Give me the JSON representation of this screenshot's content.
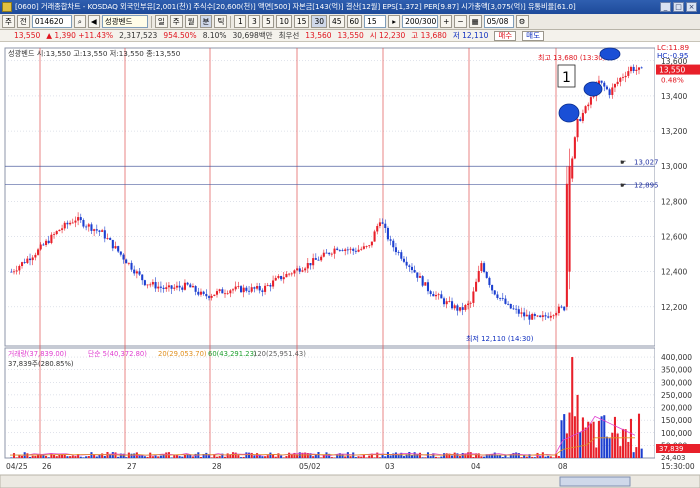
{
  "window": {
    "title": "[0600] 거래종합차트 - KOSDAQ 외국인부유[2,001(천)] 주식수[20,600(천)] 액면[500] 자본금[143(억)] 결산[12월] EPS[1,372] PER[9.87] 시가총액[3,075(억)] 유통비율[61.0]",
    "controls": [
      "_",
      "□",
      "×"
    ]
  },
  "toolbar": {
    "period_type": "주",
    "period_sel": "전",
    "code": "014620",
    "name": "성광벤드",
    "buttons": [
      "일",
      "주",
      "월",
      "분",
      "틱"
    ],
    "intervals": [
      "1",
      "3",
      "5",
      "10",
      "15",
      "30",
      "45",
      "60"
    ],
    "count": "15",
    "range": "200/300",
    "date": "05/08"
  },
  "info": {
    "price": "13,550",
    "change": "▲ 1,390 +11.43%",
    "volume": "2,317,523",
    "vol_pct": "954.50%",
    "turnover": "8.10%",
    "amount": "30,698백만",
    "prev_label": "최우선",
    "prev_price": "13,560",
    "prev_price2": "13,550",
    "low_label": "시 12,230",
    "high_label": "고 13,680",
    "close_label": "저 12,110",
    "buy": "매수",
    "sell": "매도"
  },
  "price_panel": {
    "legend": "성광벤드 시:13,550 고:13,550 저:13,550 종:13,550",
    "lc": "LC:11.89",
    "hc": "HC:-0.95",
    "high_annot": "최고 13,680 (13:30)",
    "low_annot": "최저 12,110 (14:30)",
    "box_num": "1",
    "cur_price": "13,550",
    "cur_pct": "0.48%",
    "ref_lines": [
      {
        "value": 13027,
        "label": "13,027"
      },
      {
        "value": 12895,
        "label": "12,895"
      }
    ],
    "horiz_lines": [
      13000,
      12895
    ]
  },
  "volume_panel": {
    "legend": [
      "거래량(37,839.00)",
      "단순 5(40,372.80)",
      "20(29,053.70)",
      "60(43,291.23)",
      "120(25,951.43)"
    ],
    "legend2": "37,839주(280.85%)",
    "cur_vol": "37,839",
    "cur_vol2": "24,403"
  },
  "colors": {
    "up": "#e8202a",
    "down": "#1c3fd0",
    "vline": "#e05050",
    "grid": "#bfc6d6",
    "ma5": "#e040d0",
    "ma20": "#e09020",
    "ma60": "#20a030",
    "ma120": "#606060"
  },
  "chart_data": {
    "type": "candlestick",
    "price_axis": {
      "min": 12000,
      "max": 13650,
      "ticks": [
        13600,
        13400,
        13200,
        13000,
        12800,
        12600,
        12400,
        12200
      ]
    },
    "price_tick_labels": [
      "13,600",
      "13,400",
      "13,200",
      "13,000",
      "12,800",
      "12,600",
      "12,400",
      "12,200"
    ],
    "volume_axis": {
      "min": 0,
      "max": 420000,
      "ticks": [
        400000,
        350000,
        300000,
        250000,
        200000,
        150000,
        100000,
        50000
      ]
    },
    "volume_tick_labels": [
      "400,000",
      "350,000",
      "300,000",
      "250,000",
      "200,000",
      "150,000",
      "100,000",
      "50,000"
    ],
    "date_labels": [
      "04/25",
      "26",
      "27",
      "28",
      "05/02",
      "03",
      "04",
      "08"
    ],
    "time_label": "15:30:00",
    "series_description": "intraday minute candles 04/25 - 05/08",
    "n_bars": 200
  }
}
